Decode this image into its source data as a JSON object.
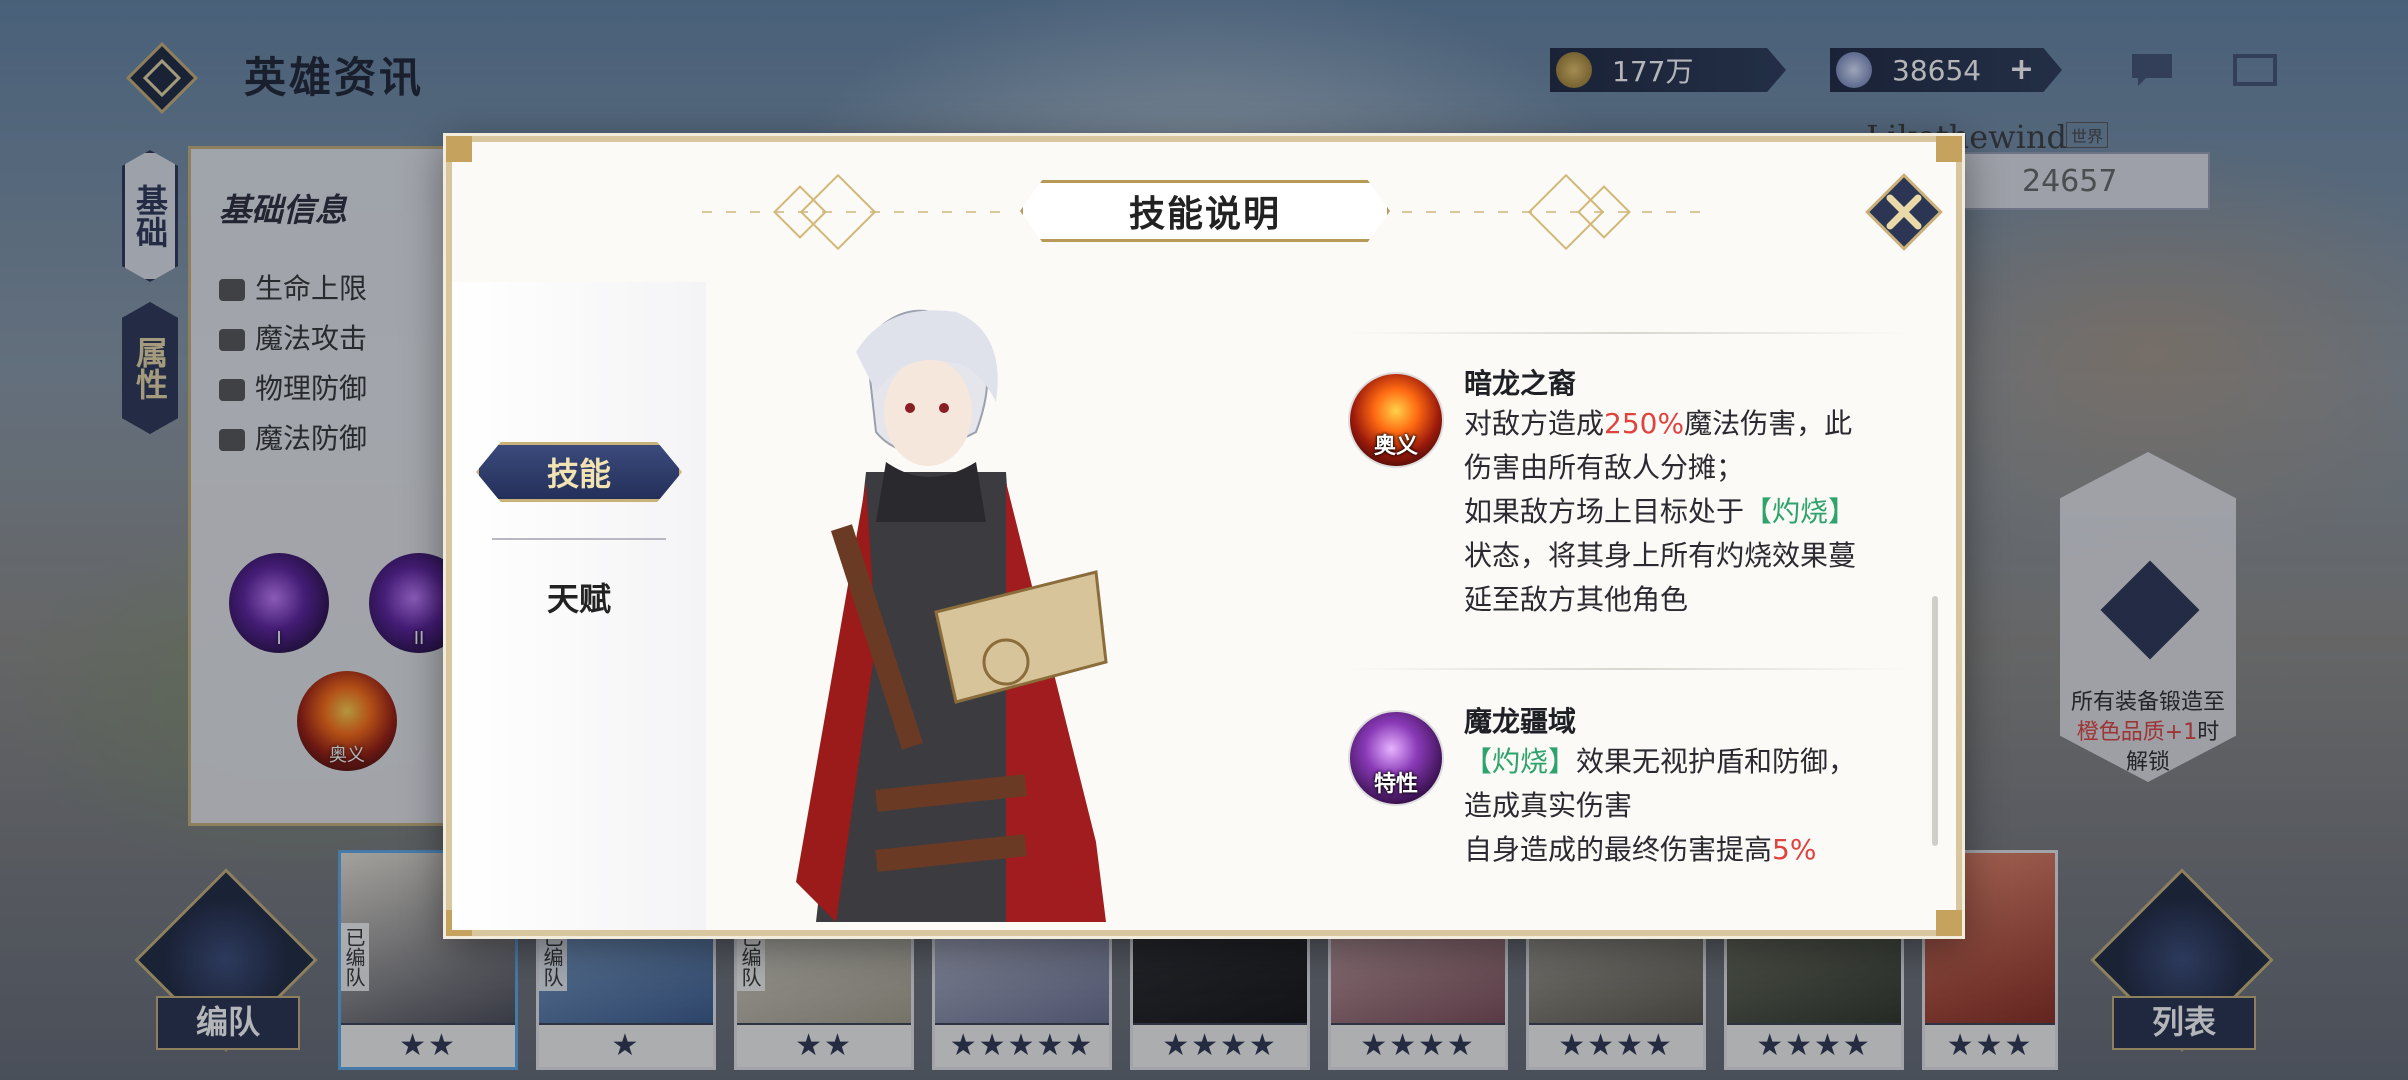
{
  "header": {
    "title": "英雄资讯",
    "gold": "177万",
    "gems": "38654",
    "plus": "+"
  },
  "profile": {
    "name": "Likethewind",
    "world_tag": "世界",
    "power": "24657"
  },
  "left_panel": {
    "tabs": [
      {
        "label": "基础"
      },
      {
        "label": "属性"
      }
    ],
    "title": "基础信息",
    "stats": [
      "生命上限",
      "魔法攻击",
      "物理防御",
      "魔法防御"
    ],
    "orb_labels": [
      "I",
      "II",
      "奥义"
    ]
  },
  "right_card": {
    "unlock_text_pre": "所有装备锻造至",
    "unlock_text_quality": "橙色品质+1",
    "unlock_text_post": "时解锁"
  },
  "modal": {
    "title": "技能说明",
    "tabs": {
      "skill": "技能",
      "talent": "天赋"
    },
    "skills": [
      {
        "name": "暗龙之裔",
        "tag": "奥义",
        "line1_pre": "对敌方造成",
        "line1_val": "250%",
        "line1_post": "魔法伤害，此",
        "line2": "伤害由所有敌人分摊；",
        "line3_pre": "如果敌方场上目标处于",
        "line3_kw": "【灼烧】",
        "line4": "状态，将其身上所有灼烧效果蔓",
        "line5": "延至敌方其他角色"
      },
      {
        "name": "魔龙疆域",
        "tag": "特性",
        "line1_kw": "【灼烧】",
        "line1_post": "效果无视护盾和防御，",
        "line2": "造成真实伤害",
        "line3_pre": "自身造成的最终伤害提高",
        "line3_val": "5%"
      }
    ]
  },
  "roster": {
    "team_tag": "已编队",
    "stars": [
      "★★",
      "★",
      "★★",
      "★★★★★",
      "★★★★",
      "★★★★",
      "★★★★",
      "★★★★",
      "★★★"
    ]
  },
  "buttons": {
    "team": "编队",
    "list": "列表"
  },
  "colors": {
    "accent_navy": "#2c3654",
    "gold_trim": "#c9b27a",
    "red_value": "#e0433f",
    "green_keyword": "#2ea36b"
  }
}
